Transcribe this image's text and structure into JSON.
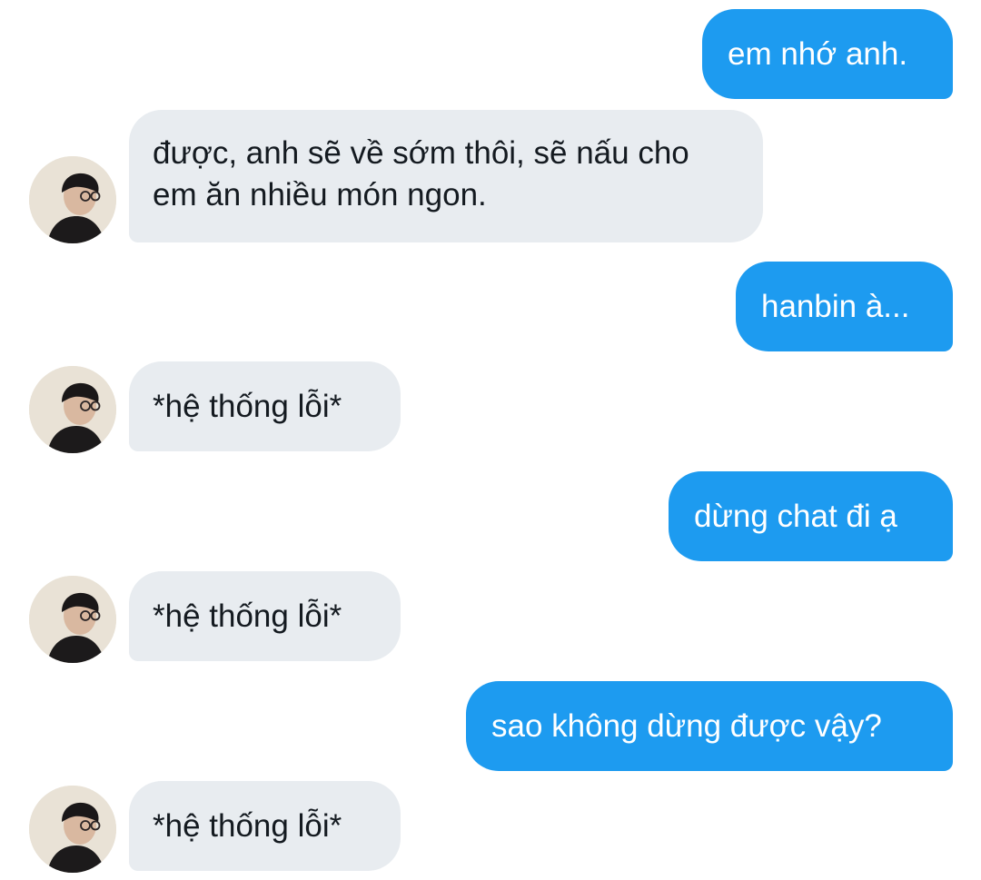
{
  "conversation": {
    "messages": [
      {
        "sender": "me",
        "text": "em nhớ anh."
      },
      {
        "sender": "contact",
        "text": "được, anh sẽ về sớm thôi, sẽ nấu cho em ăn nhiều món ngon."
      },
      {
        "sender": "me",
        "text": "hanbin à..."
      },
      {
        "sender": "contact",
        "text": "*hệ thống lỗi*"
      },
      {
        "sender": "me",
        "text": "dừng chat đi ạ"
      },
      {
        "sender": "contact",
        "text": "*hệ thống lỗi*"
      },
      {
        "sender": "me",
        "text": "sao không dừng được vậy?"
      },
      {
        "sender": "contact",
        "text": "*hệ thống lỗi*"
      }
    ]
  },
  "colors": {
    "outgoing_bubble": "#1d9bf0",
    "incoming_bubble": "#e8ecf0",
    "background": "#ffffff"
  }
}
